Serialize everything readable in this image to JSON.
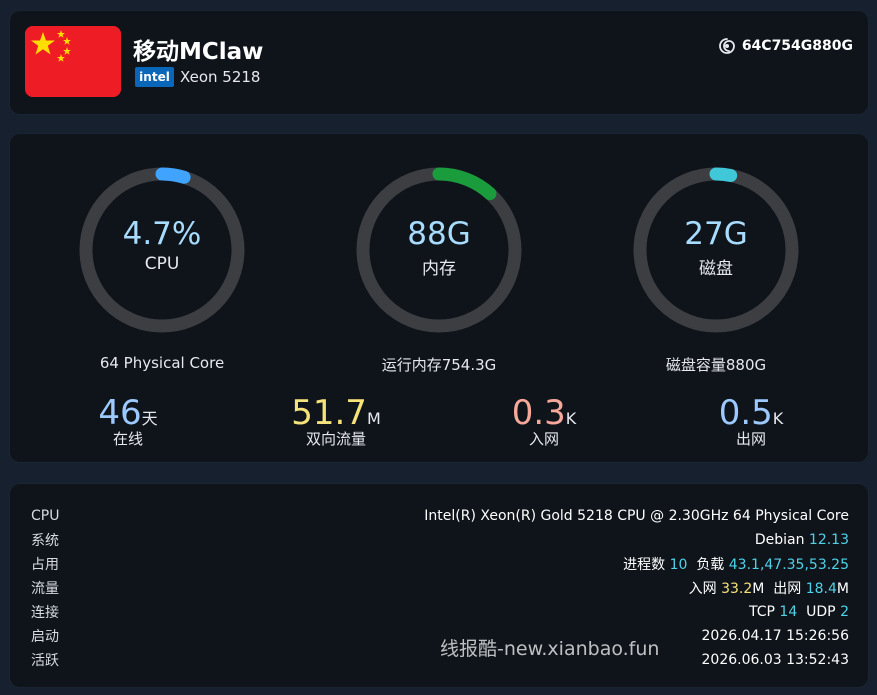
{
  "header": {
    "server_name": "移动MClaw",
    "cpu_brand": "intel",
    "cpu_model": "Xeon 5218",
    "server_id": "64C754G880G",
    "icons": {
      "flag": "china-flag-icon",
      "id": "spiral-id-icon"
    }
  },
  "gauges": [
    {
      "value": "4.7%",
      "label": "CPU",
      "caption": "64 Physical Core",
      "percent": 4.7,
      "color": "#3fa3ff",
      "label_color": "#a8dcff"
    },
    {
      "value": "88G",
      "label": "内存",
      "caption": "运行内存754.3G",
      "percent": 11.7,
      "color": "#1a9b3c",
      "label_color": "#a8dcff"
    },
    {
      "value": "27G",
      "label": "磁盘",
      "caption": "磁盘容量880G",
      "percent": 3.1,
      "color": "#40c7d8",
      "label_color": "#a8dcff"
    }
  ],
  "stats": [
    {
      "value": "46",
      "unit": "天",
      "label": "在线",
      "color": "#9cc9ff"
    },
    {
      "value": "51.7",
      "unit": "M",
      "label": "双向流量",
      "color": "#f5e27a"
    },
    {
      "value": "0.3",
      "unit": "K",
      "label": "入网",
      "color": "#f6a89a"
    },
    {
      "value": "0.5",
      "unit": "K",
      "label": "出网",
      "color": "#9cc9ff"
    }
  ],
  "details": {
    "cpu": {
      "key": "CPU",
      "value": "Intel(R) Xeon(R) Gold 5218 CPU @ 2.30GHz 64 Physical Core"
    },
    "system": {
      "key": "系统",
      "name": "Debian",
      "version": "12.13"
    },
    "usage": {
      "key": "占用",
      "proc_label": "进程数",
      "proc_value": "10",
      "load_label": "负载",
      "load_value": "43.1,47.35,53.25"
    },
    "traffic": {
      "key": "流量",
      "in_label": "入网",
      "in_value": "33.2",
      "in_unit": "M",
      "out_label": "出网",
      "out_value": "18.4",
      "out_unit": "M"
    },
    "connections": {
      "key": "连接",
      "tcp_label": "TCP",
      "tcp_value": "14",
      "udp_label": "UDP",
      "udp_value": "2"
    },
    "boot": {
      "key": "启动",
      "value": "2026.04.17 15:26:56"
    },
    "active": {
      "key": "活跃",
      "value": "2026.06.03 13:52:43"
    }
  },
  "watermark": "线报酷-new.xianbao.fun"
}
